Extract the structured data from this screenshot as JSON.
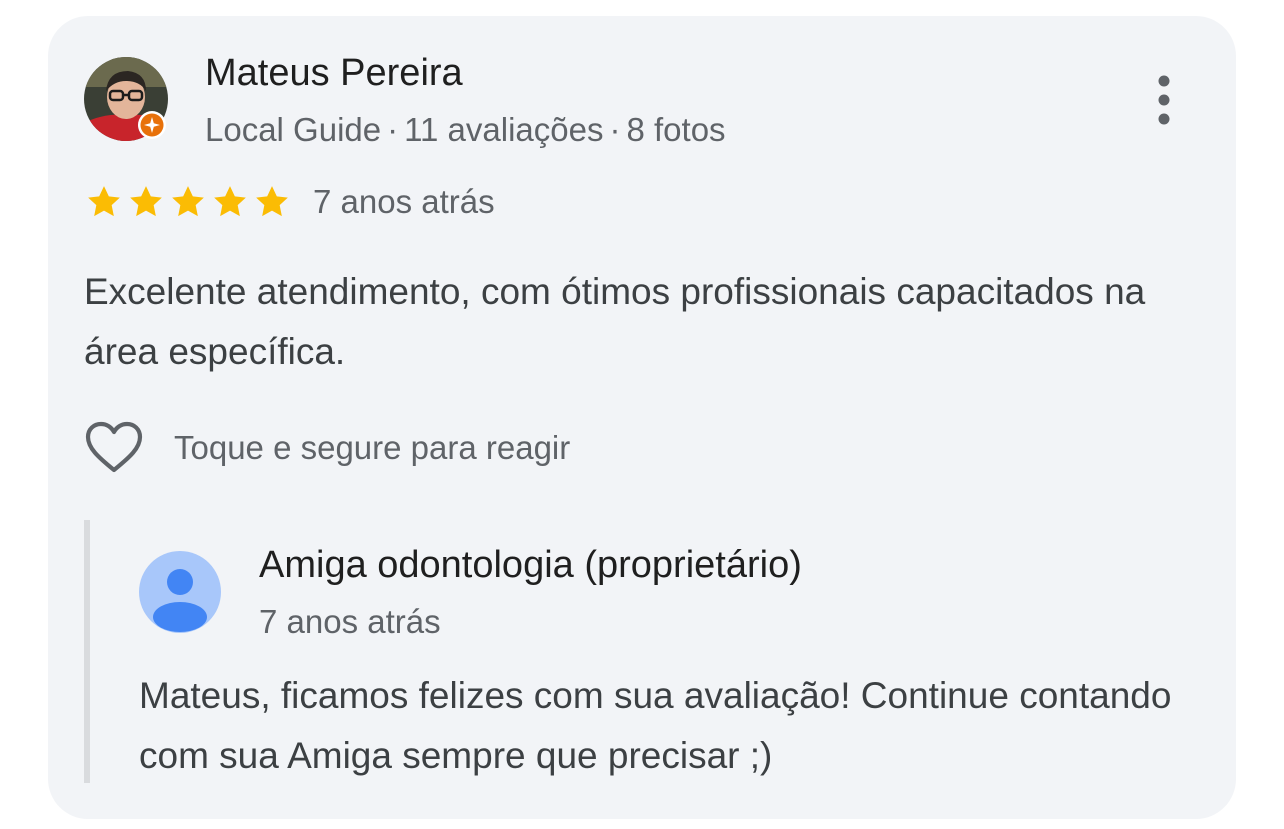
{
  "review": {
    "author": {
      "name": "Mateus Pereira",
      "level": "Local Guide",
      "reviews_count": "11 avaliações",
      "photos_count": "8 fotos",
      "separator": "·",
      "avatar_icon": "user-photo",
      "badge_icon": "local-guide-badge-icon"
    },
    "rating": 5,
    "rating_max": 5,
    "time": "7 anos atrás",
    "text": "Excelente atendimento, com ótimos profissionais capacitados na área específica.",
    "react_label": "Toque e segure para reagir",
    "react_icon": "heart-outline-icon",
    "more_icon": "more-vert-icon"
  },
  "owner_reply": {
    "name": "Amiga odontologia (proprietário)",
    "time": "7 anos atrás",
    "text": "Mateus, ficamos felizes com sua avaliação! Continue contando com sua Amiga sempre que precisar ;)",
    "avatar_icon": "default-person-icon"
  },
  "colors": {
    "card_background": "#f2f4f7",
    "star": "#fbbc04",
    "badge": "#e8710a",
    "secondary_text": "#5f6368",
    "primary_text": "#1f1f1f",
    "body_text": "#3c4043",
    "owner_avatar_bg": "#a8c7fa",
    "owner_avatar_fg": "#4285f4"
  }
}
